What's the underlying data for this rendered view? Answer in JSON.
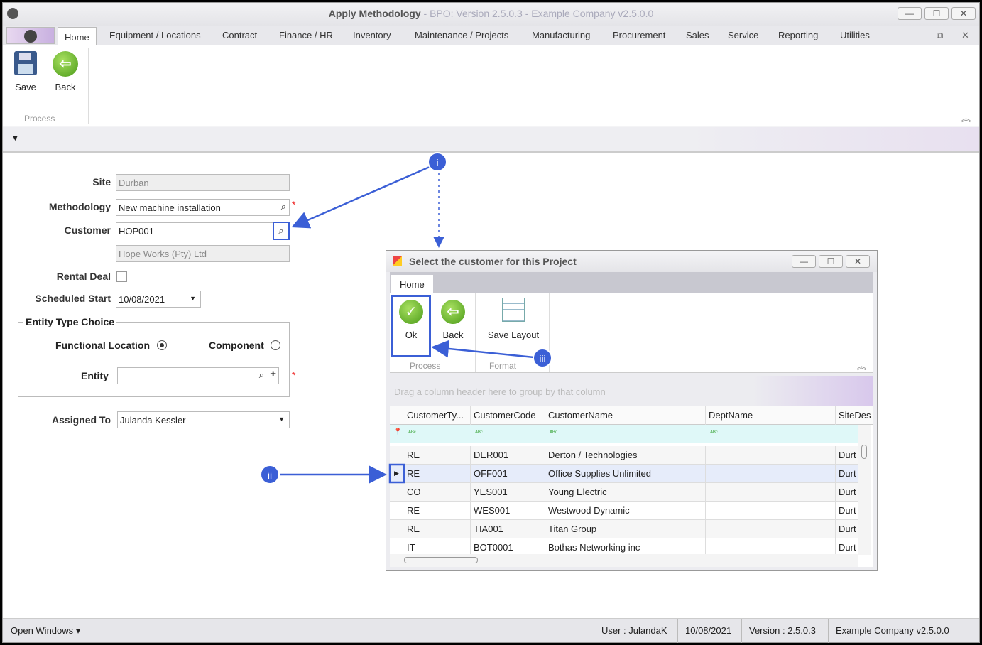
{
  "window": {
    "title": "Apply Methodology",
    "subtitle": " - BPO: Version 2.5.0.3 - Example Company v2.5.0.0",
    "min": "—",
    "max": "☐",
    "close": "✕"
  },
  "tabs": [
    "Home",
    "Equipment / Locations",
    "Contract",
    "Finance / HR",
    "Inventory",
    "Maintenance / Projects",
    "Manufacturing",
    "Procurement",
    "Sales",
    "Service",
    "Reporting",
    "Utilities"
  ],
  "ribbon": {
    "save": "Save",
    "back": "Back",
    "group": "Process"
  },
  "form": {
    "site_label": "Site",
    "site": "Durban",
    "methodology_label": "Methodology",
    "methodology": "New machine installation",
    "customer_label": "Customer",
    "customer": "HOP001",
    "customer_name": "Hope Works (Pty) Ltd",
    "rental_label": "Rental Deal",
    "start_label": "Scheduled Start",
    "start": "10/08/2021",
    "entity_group": "Entity Type Choice",
    "functional": "Functional Location",
    "component": "Component",
    "entity_label": "Entity",
    "entity": "",
    "assigned_label": "Assigned To",
    "assigned": "Julanda Kessler",
    "required": "*"
  },
  "dialog": {
    "title": "Select the customer for this Project",
    "tab": "Home",
    "ok": "Ok",
    "back": "Back",
    "save_layout": "Save Layout",
    "group_process": "Process",
    "group_format": "Format",
    "group_hint": "Drag a column header here to group by that column",
    "columns": [
      "CustomerTy...",
      "CustomerCode",
      "CustomerName",
      "DeptName",
      "SiteDes"
    ],
    "rows": [
      [
        "RE",
        "DER001",
        "Derton / Technologies",
        "",
        "Durt"
      ],
      [
        "RE",
        "OFF001",
        "Office Supplies Unlimited",
        "",
        "Durt"
      ],
      [
        "CO",
        "YES001",
        "Young Electric",
        "",
        "Durt"
      ],
      [
        "RE",
        "WES001",
        "Westwood Dynamic",
        "",
        "Durt"
      ],
      [
        "RE",
        "TIA001",
        "Titan Group",
        "",
        "Durt"
      ],
      [
        "IT",
        "BOT0001",
        "Bothas Networking inc",
        "",
        "Durt"
      ]
    ],
    "selected_row": 1
  },
  "annotations": {
    "i": "i",
    "ii": "ii",
    "iii": "iii",
    "color": "#3b5fd6"
  },
  "status": {
    "open_windows": "Open Windows ▾",
    "user": "User : JulandaK",
    "date": "10/08/2021",
    "version": "Version : 2.5.0.3",
    "company": "Example Company v2.5.0.0"
  }
}
